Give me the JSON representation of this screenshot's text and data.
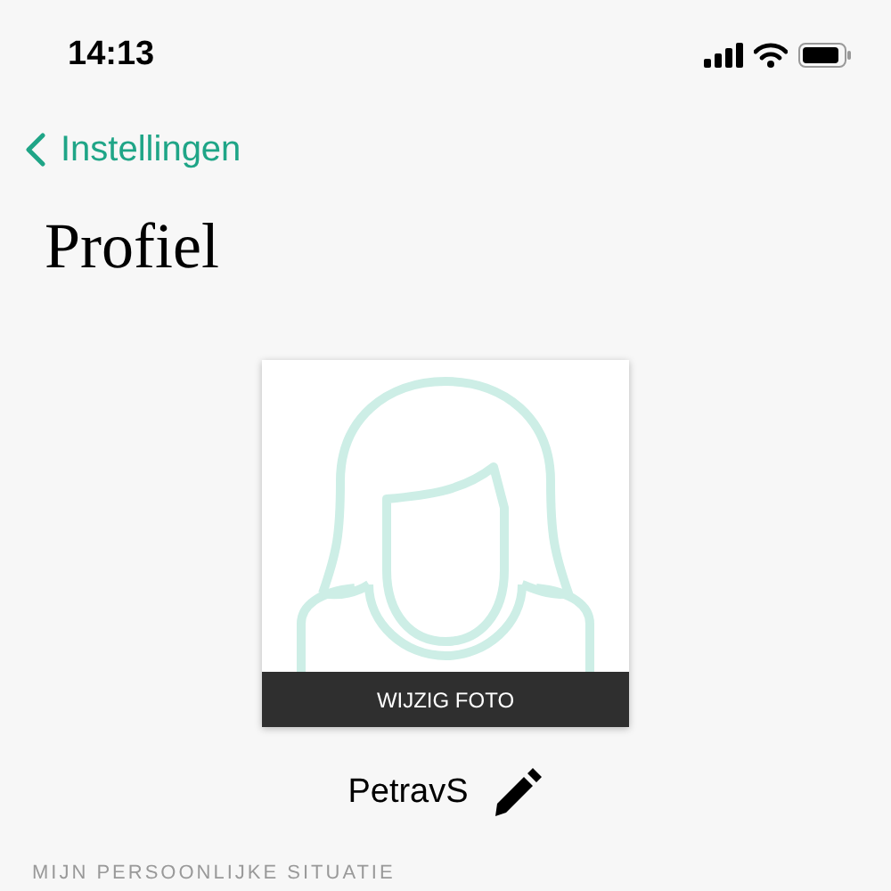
{
  "status_bar": {
    "time": "14:13"
  },
  "nav": {
    "back_label": "Instellingen"
  },
  "title": "Profiel",
  "photo": {
    "button": "WIJZIG FOTO"
  },
  "username": "PetravS",
  "section_header": "MIJN PERSOONLIJKE SITUATIE"
}
